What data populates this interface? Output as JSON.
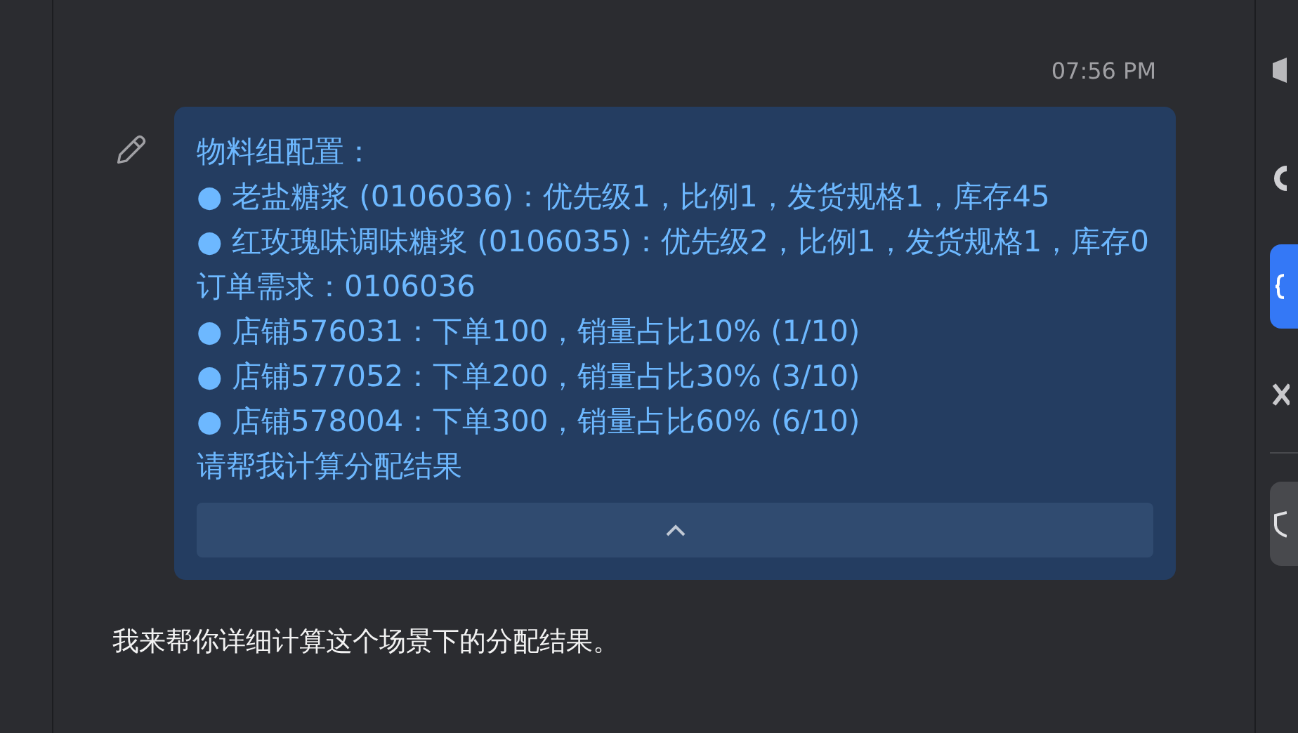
{
  "message": {
    "time": "07:56 PM",
    "lines": [
      "物料组配置：",
      "● 老盐糖浆 (0106036)：优先级1，比例1，发货规格1，库存45",
      "● 红玫瑰味调味糖浆 (0106035)：优先级2，比例1，发货规格1，库存0",
      "订单需求：0106036",
      "● 店铺576031：下单100，销量占比10% (1/10)",
      "● 店铺577052：下单200，销量占比30% (3/10)",
      "● 店铺578004：下单300，销量占比60% (6/10)",
      "请帮我计算分配结果"
    ],
    "expanded": true
  },
  "reply": {
    "text": "我来帮你详细计算这个场景下的分配结果。"
  },
  "sidebar": {
    "items": [
      {
        "kind": "cube",
        "selected": false
      },
      {
        "kind": "ring",
        "selected": false
      },
      {
        "kind": "braces",
        "selected": true
      },
      {
        "kind": "cross",
        "selected": false
      },
      {
        "kind": "divider"
      },
      {
        "kind": "shield",
        "selected": false
      }
    ]
  }
}
